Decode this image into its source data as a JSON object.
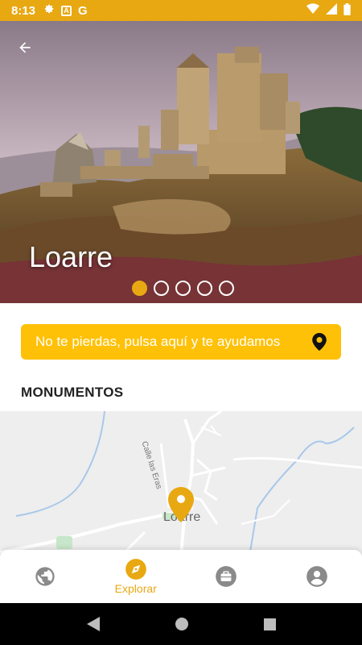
{
  "status_bar": {
    "time": "8:13",
    "icons_left": [
      "gear-icon",
      "a-icon",
      "google-icon"
    ],
    "icons_right": [
      "wifi-icon",
      "signal-icon",
      "battery-icon"
    ],
    "a_letter": "A",
    "g_letter": "G"
  },
  "hero": {
    "title": "Loarre",
    "slides_total": 5,
    "active_slide": 1
  },
  "help_banner": {
    "text": "No te pierdas, pulsa aquí y te ayudamos"
  },
  "section": {
    "title": "MONUMENTOS"
  },
  "map": {
    "street_label": "Calle las Eras",
    "town_label": "Loarre"
  },
  "bottom_nav": {
    "items": [
      {
        "icon": "globe-icon",
        "label": ""
      },
      {
        "icon": "compass-icon",
        "label": "Explorar",
        "active": true
      },
      {
        "icon": "briefcase-icon",
        "label": ""
      },
      {
        "icon": "profile-icon",
        "label": ""
      }
    ]
  },
  "colors": {
    "accent": "#e8a812",
    "banner": "#ffc107"
  }
}
